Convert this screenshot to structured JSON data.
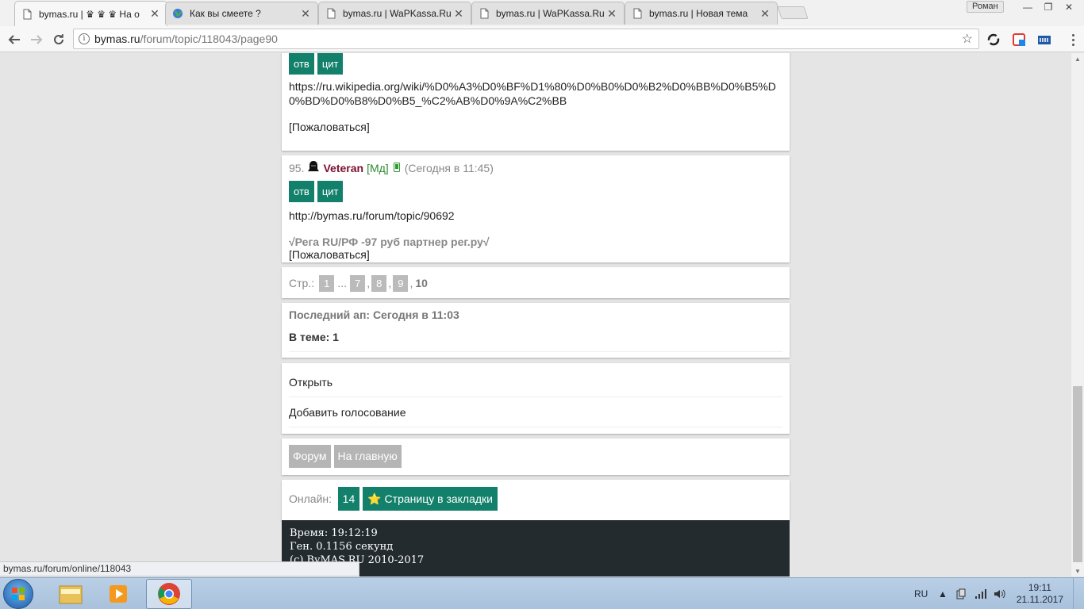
{
  "browser": {
    "tabs": [
      {
        "title": "bymas.ru | ♛ ♛ ♛ На о",
        "active": true,
        "icon": "page-icon"
      },
      {
        "title": "Как вы смеете ?",
        "active": false,
        "icon": "globe-icon"
      },
      {
        "title": "bymas.ru | WaPKassa.Ru",
        "active": false,
        "icon": "page-icon"
      },
      {
        "title": "bymas.ru | WaPKassa.Ru",
        "active": false,
        "icon": "page-icon"
      },
      {
        "title": "bymas.ru | Новая тема",
        "active": false,
        "icon": "page-icon"
      }
    ],
    "profile_name": "Роман",
    "url_host": "bymas.ru",
    "url_path": "/forum/topic/118043/page90",
    "status_url": "bymas.ru/forum/online/118043"
  },
  "page": {
    "post94": {
      "reply_label": "отв",
      "quote_label": "цит",
      "text": "https://ru.wikipedia.org/wiki/%D0%A3%D0%BF%D1%80%D0%B0%D0%B2%D0%BB%D0%B5%D0%BD%D0%B8%D0%B5_%C2%AB%D0%9A%C2%BB",
      "complain": "[Пожаловаться]"
    },
    "post95": {
      "number": "95.",
      "author": "Veteran",
      "role": "[Мд]",
      "time": "(Сегодня в 11:45)",
      "reply_label": "отв",
      "quote_label": "цит",
      "text": "http://bymas.ru/forum/topic/90692",
      "signature": "√Рега RU/РФ -97 руб партнер рег.ру√",
      "complain": "[Пожаловаться]"
    },
    "pager": {
      "label": "Стр.:",
      "first": "1",
      "ellipsis": "...",
      "pages": [
        "7",
        "8",
        "9"
      ],
      "current": "10"
    },
    "topic_info": {
      "last_up": "Последний ап: Сегодня в 11:03",
      "in_topic": "В теме: 1"
    },
    "actions": {
      "open": "Открыть",
      "add_poll": "Добавить голосование"
    },
    "nav": {
      "forum": "Форум",
      "home": "На главную"
    },
    "online": {
      "label": "Онлайн:",
      "count": "14",
      "bookmark": "⭐ Страницу в закладки"
    },
    "footer": {
      "time": "Время: 19:12:19",
      "gen": "Ген. 0.1156 секунд",
      "copyright": "(c) ByMAS.RU 2010-2017"
    }
  },
  "taskbar": {
    "lang": "RU",
    "time": "19:11",
    "date": "21.11.2017"
  },
  "colors": {
    "accent_green": "#12806a",
    "footer_bg": "#232b2e",
    "username": "#7a1030"
  }
}
